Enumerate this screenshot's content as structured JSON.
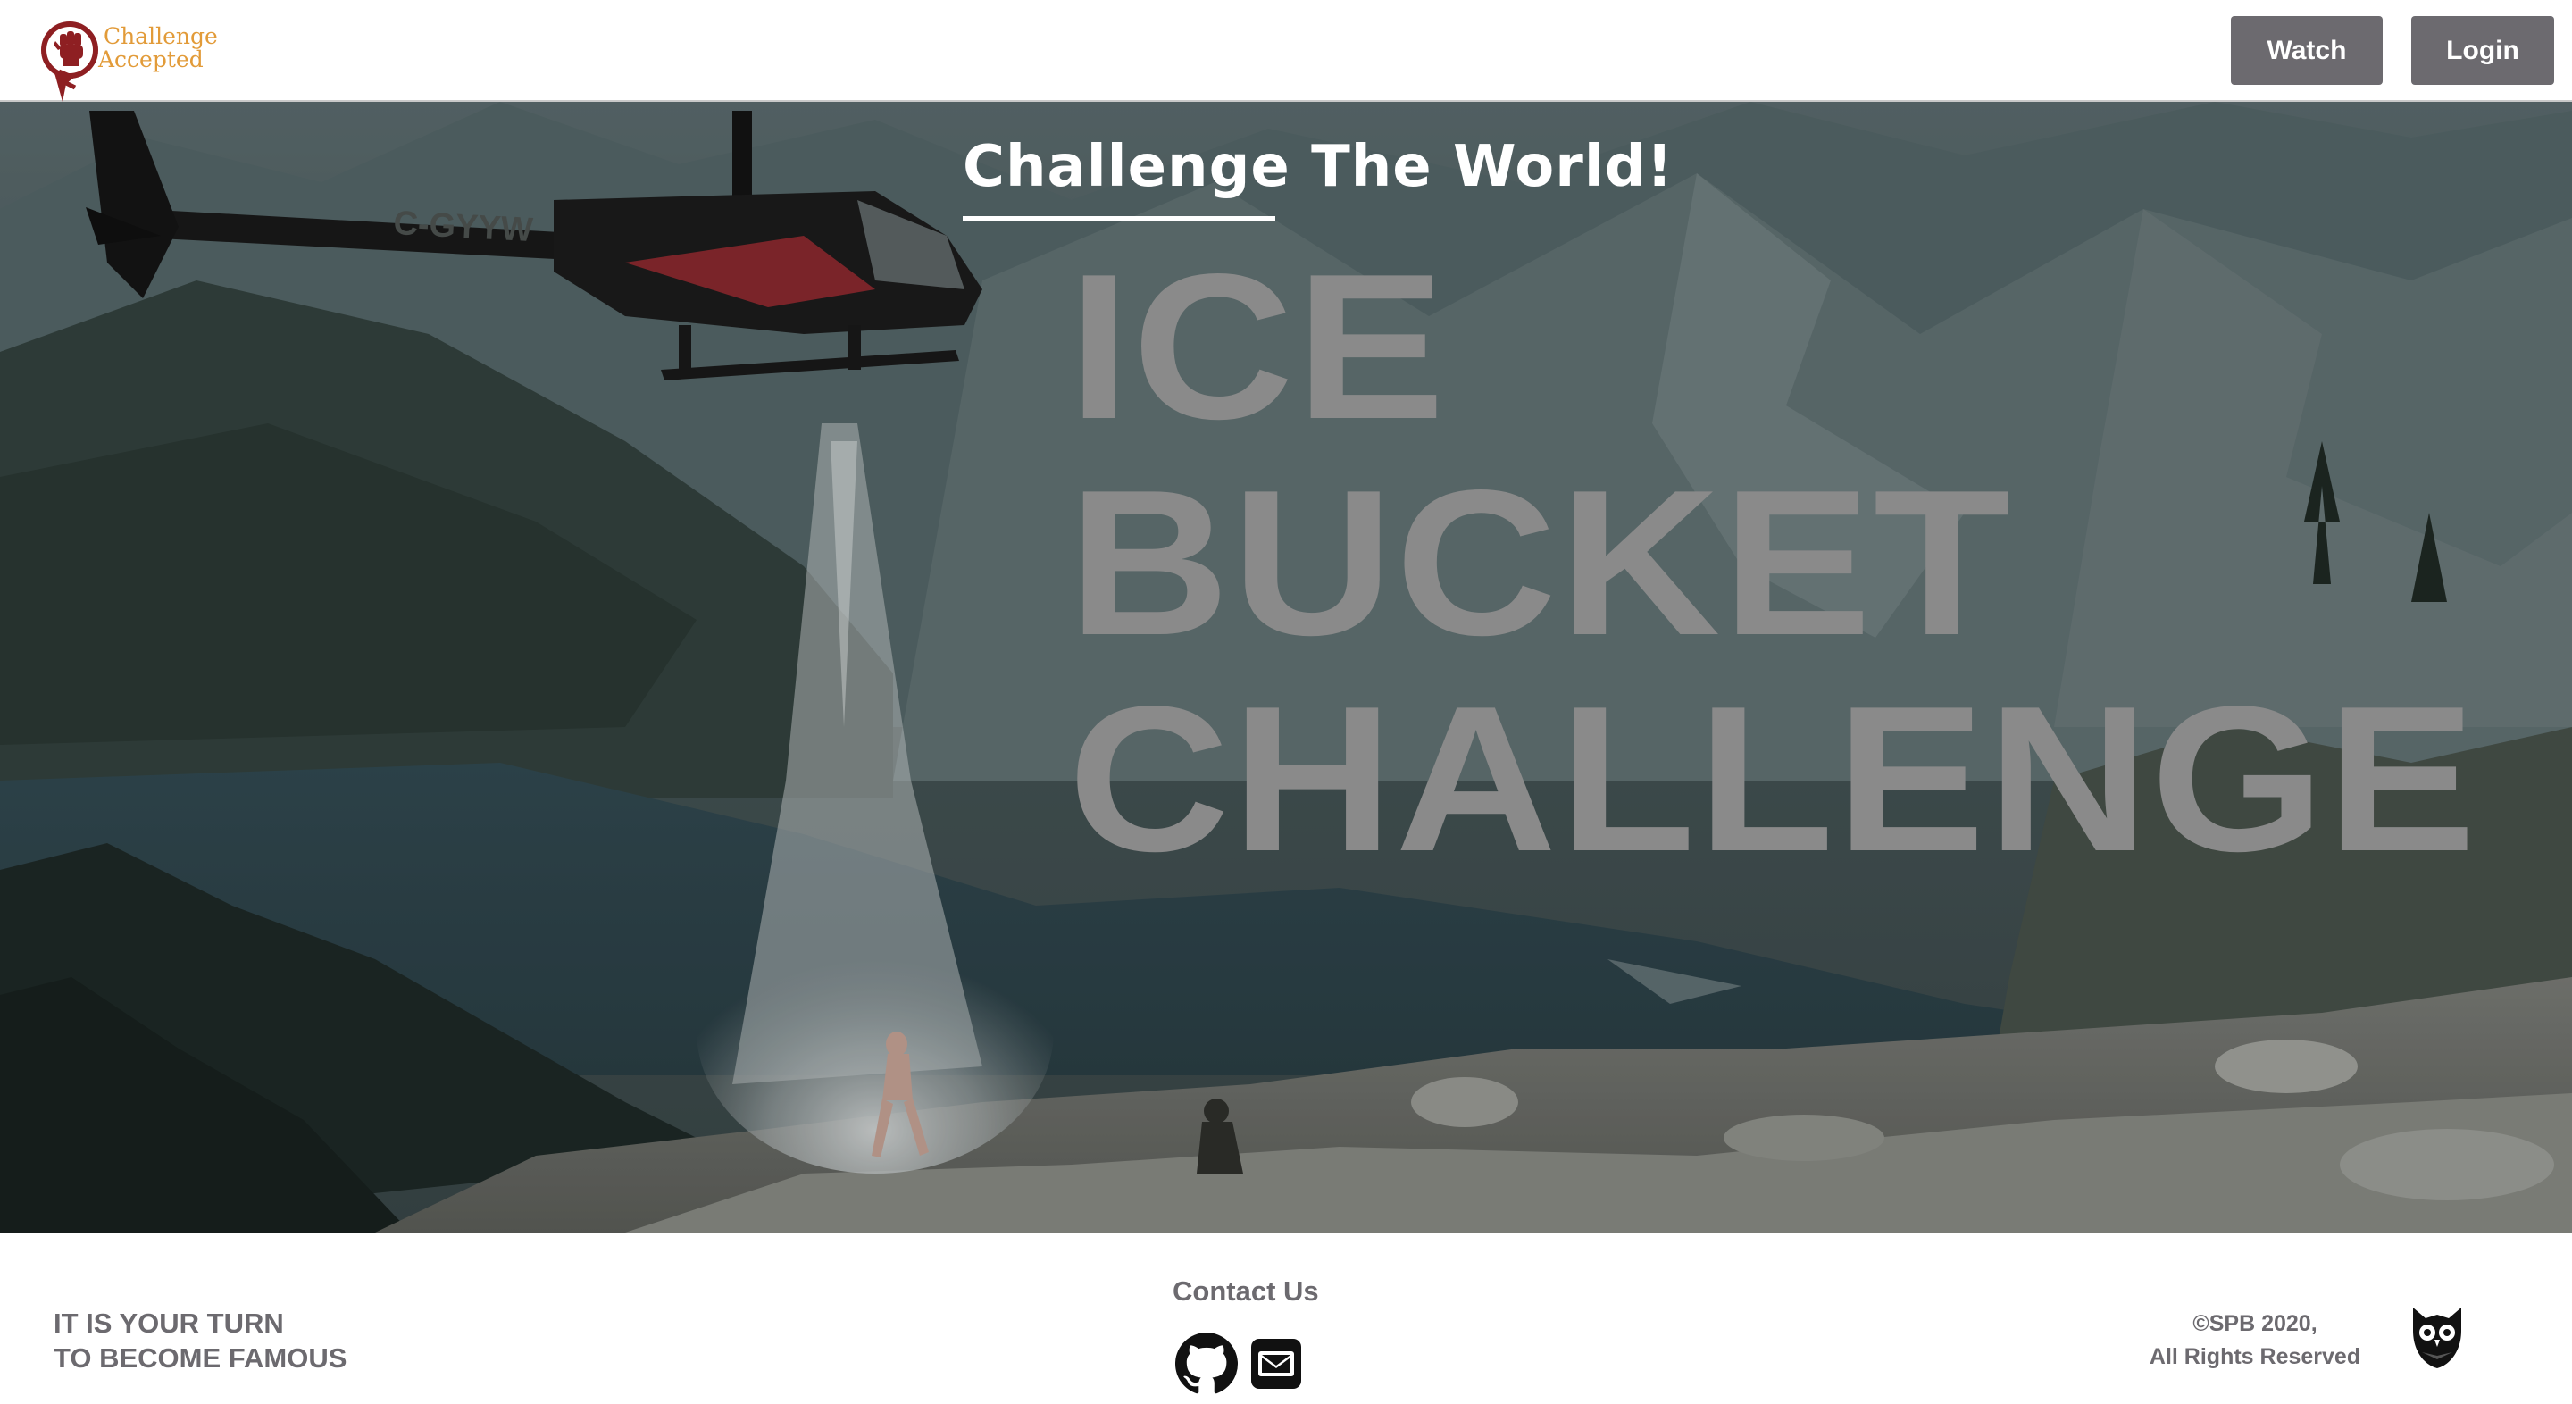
{
  "brand": {
    "logo_line1": "Challenge",
    "logo_line2": "Accepted",
    "logo_icon": "fist-pin-icon",
    "accent_color": "#e29b39",
    "mark_color": "#8e1f22"
  },
  "nav": {
    "watch_label": "Watch",
    "login_label": "Login",
    "button_color": "#6c6a6f"
  },
  "hero": {
    "tagline_underlined": "Challenge",
    "tagline_rest": " The World!",
    "headline_line1": "ICE",
    "headline_line2": "BUCKET",
    "headline_line3": "CHALLENGE",
    "headline_color": "#8a8a8a",
    "background_scene": "helicopter-dropping-water-on-mountain-cliff",
    "helicopter_registration": "C-GYYW"
  },
  "footer": {
    "slogan_line1": "IT IS YOUR TURN",
    "slogan_line2": "TO BECOME FAMOUS",
    "contact_title": "Contact Us",
    "contact_icons": [
      "github-icon",
      "mail-icon"
    ],
    "copyright_line1": "©SPB 2020,",
    "copyright_line2": "All Rights Reserved",
    "author_icon": "owl-icon",
    "text_color": "#6c6a6f"
  }
}
